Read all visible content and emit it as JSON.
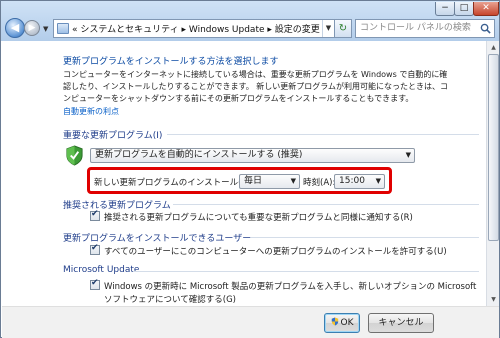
{
  "window": {
    "min_glyph": "−",
    "max_glyph": "□",
    "close_glyph": "✕"
  },
  "nav": {
    "back_glyph": "◀",
    "forward_glyph": "▶",
    "history_glyph": "▼"
  },
  "address": {
    "prefix": "«",
    "crumbs": [
      "システムとセキュリティ",
      "Windows Update",
      "設定の変更"
    ],
    "separator": "▸",
    "dropdown_glyph": "▼",
    "refresh_glyph": "↻"
  },
  "search": {
    "placeholder": "コントロール パネルの検索"
  },
  "content": {
    "heading": "更新プログラムをインストールする方法を選択します",
    "description_lines": [
      "コンピューターをインターネットに接続している場合は、重要な更新プログラムを Windows で自動的に確",
      "認したり、インストールしたりすることができます。 新しい更新プログラムが利用可能になったときは、コ",
      "ンピューターをシャットダウンする前にその更新プログラムをインストールすることもできます。"
    ],
    "auto_update_link": "自動更新の利点"
  },
  "important": {
    "section_label": "重要な更新プログラム(I)",
    "selected": "更新プログラムを自動的にインストールする (推奨)",
    "schedule_label": "新しい更新プログラムのインストール(N):",
    "day_value": "毎日",
    "time_label": "時刻(A):",
    "time_value": "15:00"
  },
  "recommended": {
    "section_label": "推奨される更新プログラム",
    "checkbox_label": "推奨される更新プログラムについても重要な更新プログラムと同様に通知する(R)",
    "checked": true
  },
  "who_can_install": {
    "section_label": "更新プログラムをインストールできるユーザー",
    "checkbox_label": "すべてのユーザーにこのコンピューターへの更新プログラムのインストールを許可する(U)",
    "checked": true
  },
  "microsoft_update": {
    "section_label": "Microsoft Update",
    "checkbox_lines": [
      "Windows の更新時に Microsoft 製品の更新プログラムを入手し、新しいオプションの Microsoft",
      "ソフトウェアについて確認する(G)"
    ],
    "checked": true
  },
  "footer": {
    "ok_label": "OK",
    "cancel_label": "キャンセル"
  },
  "colors": {
    "highlight": "#e00000",
    "section_text": "#1f3d8a",
    "link": "#0a60c8"
  },
  "icons": {
    "shield": "shield-check-icon",
    "folder": "control-panel-folder-icon",
    "search": "search-icon",
    "ok_shield": "uac-shield-icon"
  }
}
